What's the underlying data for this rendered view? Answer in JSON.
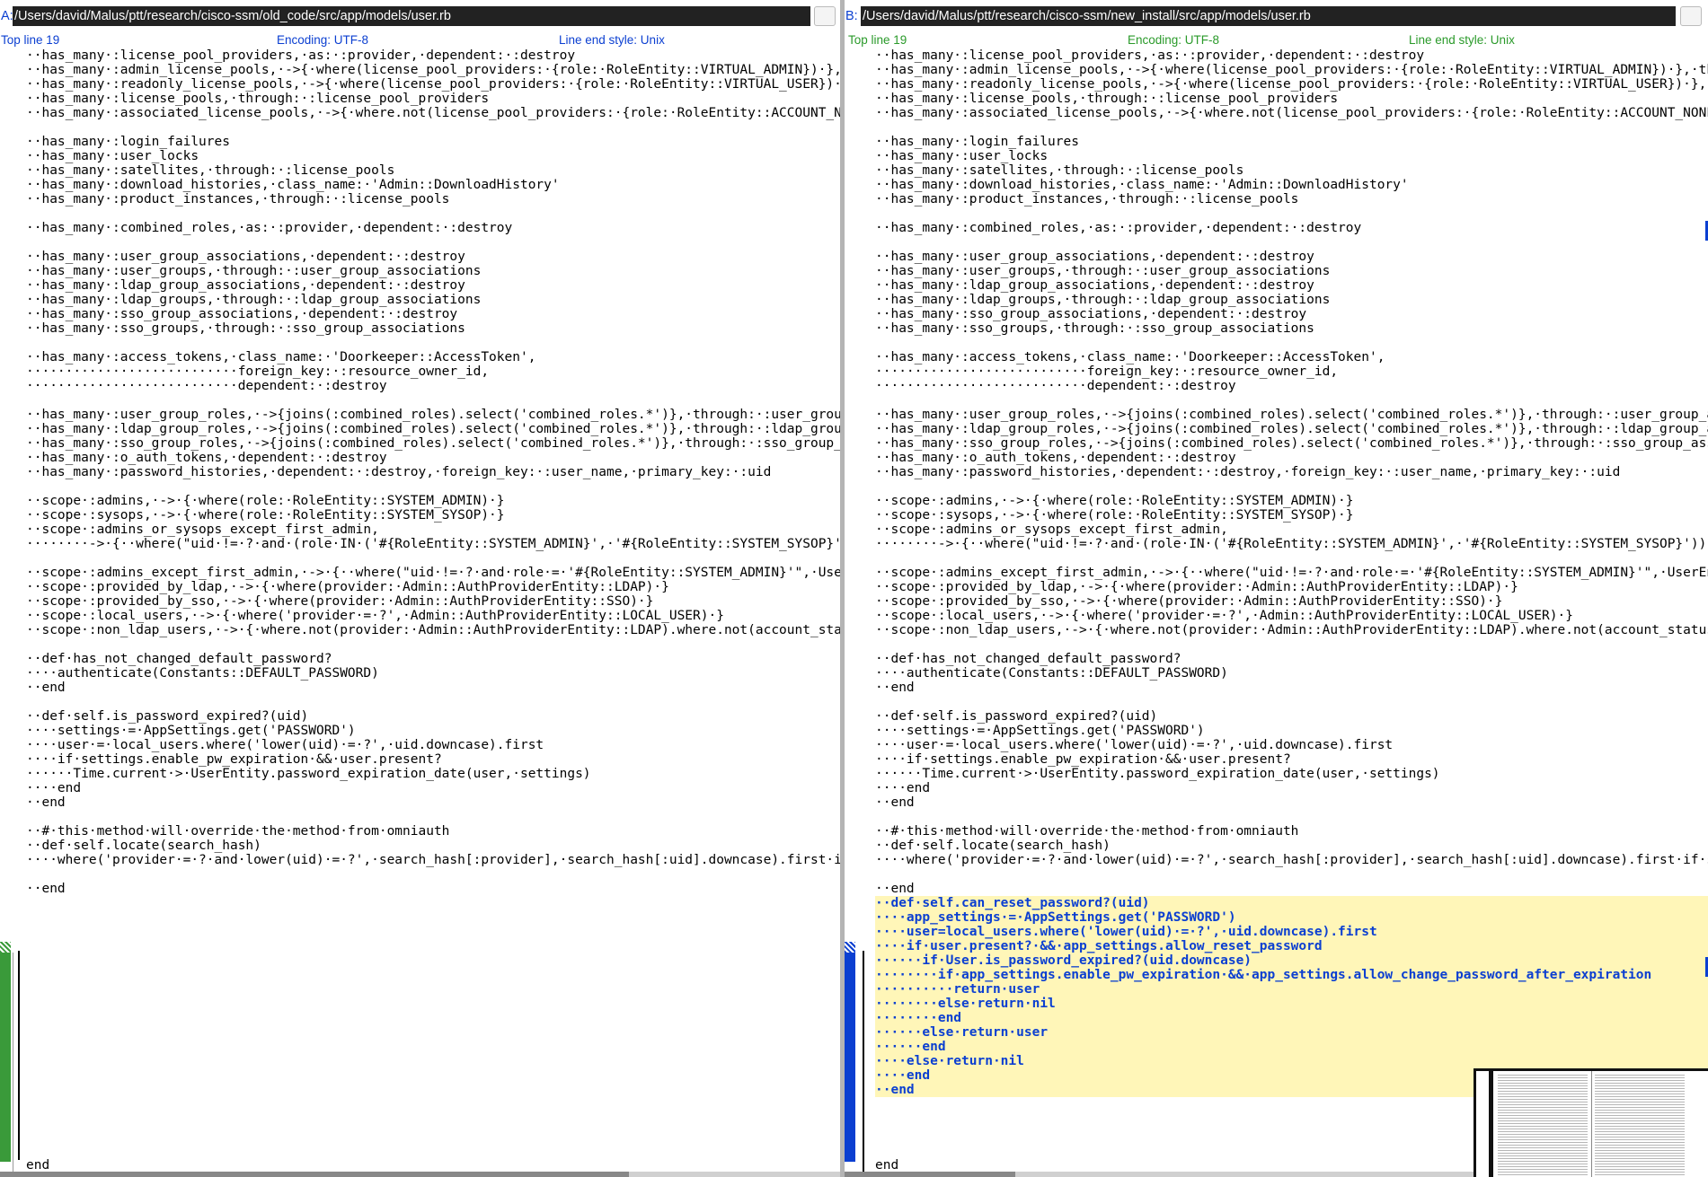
{
  "left": {
    "tag": "A:",
    "path": "/Users/david/Malus/ptt/research/cisco-ssm/old_code/src/app/models/user.rb",
    "top_line": "Top line 19",
    "encoding": "Encoding: UTF-8",
    "line_end": "Line end style: Unix",
    "lines": [
      "··has_many·:license_pool_providers,·as:·:provider,·dependent:·:destroy",
      "··has_many·:admin_license_pools,·->{·where(license_pool_providers:·{role:·RoleEntity::VIRTUAL_ADMIN})·},·thr",
      "··has_many·:readonly_license_pools,·->{·where(license_pool_providers:·{role:·RoleEntity::VIRTUAL_USER})·},·t",
      "··has_many·:license_pools,·through:·:license_pool_providers",
      "··has_many·:associated_license_pools,·->{·where.not(license_pool_providers:·{role:·RoleEntity::ACCOUNT_NONE}",
      "",
      "··has_many·:login_failures",
      "··has_many·:user_locks",
      "··has_many·:satellites,·through:·:license_pools",
      "··has_many·:download_histories,·class_name:·'Admin::DownloadHistory'",
      "··has_many·:product_instances,·through:·:license_pools",
      "",
      "··has_many·:combined_roles,·as:·:provider,·dependent:·:destroy",
      "",
      "··has_many·:user_group_associations,·dependent:·:destroy",
      "··has_many·:user_groups,·through:·:user_group_associations",
      "··has_many·:ldap_group_associations,·dependent:·:destroy",
      "··has_many·:ldap_groups,·through:·:ldap_group_associations",
      "··has_many·:sso_group_associations,·dependent:·:destroy",
      "··has_many·:sso_groups,·through:·:sso_group_associations",
      "",
      "··has_many·:access_tokens,·class_name:·'Doorkeeper::AccessToken',",
      "···························foreign_key:·:resource_owner_id,",
      "···························dependent:·:destroy",
      "",
      "··has_many·:user_group_roles,·->{joins(:combined_roles).select('combined_roles.*')},·through:·:user_group_as",
      "··has_many·:ldap_group_roles,·->{joins(:combined_roles).select('combined_roles.*')},·through:·:ldap_group_as",
      "··has_many·:sso_group_roles,·->{joins(:combined_roles).select('combined_roles.*')},·through:·:sso_group_asso",
      "··has_many·:o_auth_tokens,·dependent:·:destroy",
      "··has_many·:password_histories,·dependent:·:destroy,·foreign_key:·:user_name,·primary_key:·:uid",
      "",
      "··scope·:admins,·->·{·where(role:·RoleEntity::SYSTEM_ADMIN)·}",
      "··scope·:sysops,·->·{·where(role:·RoleEntity::SYSTEM_SYSOP)·}",
      "··scope·:admins_or_sysops_except_first_admin,",
      "········->·{··where(\"uid·!=·?·and·(role·IN·('#{RoleEntity::SYSTEM_ADMIN}',·'#{RoleEntity::SYSTEM_SYSOP}'))·\"",
      "",
      "··scope·:admins_except_first_admin,·->·{··where(\"uid·!=·?·and·role·=·'#{RoleEntity::SYSTEM_ADMIN}'\",·UserEnt",
      "··scope·:provided_by_ldap,·->·{·where(provider:·Admin::AuthProviderEntity::LDAP)·}",
      "··scope·:provided_by_sso,·->·{·where(provider:·Admin::AuthProviderEntity::SSO)·}",
      "··scope·:local_users,·->·{·where('provider·=·?',·Admin::AuthProviderEntity::LOCAL_USER)·}",
      "··scope·:non_ldap_users,·->·{·where.not(provider:·Admin::AuthProviderEntity::LDAP).where.not(account_status:",
      "",
      "··def·has_not_changed_default_password?",
      "····authenticate(Constants::DEFAULT_PASSWORD)",
      "··end",
      "",
      "··def·self.is_password_expired?(uid)",
      "····settings·=·AppSettings.get('PASSWORD')",
      "····user·=·local_users.where('lower(uid)·=·?',·uid.downcase).first",
      "····if·settings.enable_pw_expiration·&&·user.present?",
      "······Time.current·>·UserEntity.password_expiration_date(user,·settings)",
      "····end",
      "··end",
      "",
      "··#·this·method·will·override·the·method·from·omniauth",
      "··def·self.locate(search_hash)",
      "····where('provider·=·?·and·lower(uid)·=·?',·search_hash[:provider],·search_hash[:uid].downcase).first·if·se",
      "",
      "··end"
    ],
    "final_end": "end"
  },
  "right": {
    "tag": "B:",
    "path": "/Users/david/Malus/ptt/research/cisco-ssm/new_install/src/app/models/user.rb",
    "top_line": "Top line 19",
    "encoding": "Encoding: UTF-8",
    "line_end": "Line end style: Unix",
    "lines": [
      "··has_many·:license_pool_providers,·as:·:provider,·dependent:·:destroy",
      "··has_many·:admin_license_pools,·->{·where(license_pool_providers:·{role:·RoleEntity::VIRTUAL_ADMIN})·},·thr",
      "··has_many·:readonly_license_pools,·->{·where(license_pool_providers:·{role:·RoleEntity::VIRTUAL_USER})·},·t",
      "··has_many·:license_pools,·through:·:license_pool_providers",
      "··has_many·:associated_license_pools,·->{·where.not(license_pool_providers:·{role:·RoleEntity::ACCOUNT_NONE}",
      "",
      "··has_many·:login_failures",
      "··has_many·:user_locks",
      "··has_many·:satellites,·through:·:license_pools",
      "··has_many·:download_histories,·class_name:·'Admin::DownloadHistory'",
      "··has_many·:product_instances,·through:·:license_pools",
      "",
      "··has_many·:combined_roles,·as:·:provider,·dependent:·:destroy",
      "",
      "··has_many·:user_group_associations,·dependent:·:destroy",
      "··has_many·:user_groups,·through:·:user_group_associations",
      "··has_many·:ldap_group_associations,·dependent:·:destroy",
      "··has_many·:ldap_groups,·through:·:ldap_group_associations",
      "··has_many·:sso_group_associations,·dependent:·:destroy",
      "··has_many·:sso_groups,·through:·:sso_group_associations",
      "",
      "··has_many·:access_tokens,·class_name:·'Doorkeeper::AccessToken',",
      "···························foreign_key:·:resource_owner_id,",
      "···························dependent:·:destroy",
      "",
      "··has_many·:user_group_roles,·->{joins(:combined_roles).select('combined_roles.*')},·through:·:user_group_as",
      "··has_many·:ldap_group_roles,·->{joins(:combined_roles).select('combined_roles.*')},·through:·:ldap_group_as",
      "··has_many·:sso_group_roles,·->{joins(:combined_roles).select('combined_roles.*')},·through:·:sso_group_asso",
      "··has_many·:o_auth_tokens,·dependent:·:destroy",
      "··has_many·:password_histories,·dependent:·:destroy,·foreign_key:·:user_name,·primary_key:·:uid",
      "",
      "··scope·:admins,·->·{·where(role:·RoleEntity::SYSTEM_ADMIN)·}",
      "··scope·:sysops,·->·{·where(role:·RoleEntity::SYSTEM_SYSOP)·}",
      "··scope·:admins_or_sysops_except_first_admin,",
      "········->·{··where(\"uid·!=·?·and·(role·IN·('#{RoleEntity::SYSTEM_ADMIN}',·'#{RoleEntity::SYSTEM_SYSOP}'))·\"",
      "",
      "··scope·:admins_except_first_admin,·->·{··where(\"uid·!=·?·and·role·=·'#{RoleEntity::SYSTEM_ADMIN}'\",·UserEnt",
      "··scope·:provided_by_ldap,·->·{·where(provider:·Admin::AuthProviderEntity::LDAP)·}",
      "··scope·:provided_by_sso,·->·{·where(provider:·Admin::AuthProviderEntity::SSO)·}",
      "··scope·:local_users,·->·{·where('provider·=·?',·Admin::AuthProviderEntity::LOCAL_USER)·}",
      "··scope·:non_ldap_users,·->·{·where.not(provider:·Admin::AuthProviderEntity::LDAP).where.not(account_status:",
      "",
      "··def·has_not_changed_default_password?",
      "····authenticate(Constants::DEFAULT_PASSWORD)",
      "··end",
      "",
      "··def·self.is_password_expired?(uid)",
      "····settings·=·AppSettings.get('PASSWORD')",
      "····user·=·local_users.where('lower(uid)·=·?',·uid.downcase).first",
      "····if·settings.enable_pw_expiration·&&·user.present?",
      "······Time.current·>·UserEntity.password_expiration_date(user,·settings)",
      "····end",
      "··end",
      "",
      "··#·this·method·will·override·the·method·from·omniauth",
      "··def·self.locate(search_hash)",
      "····where('provider·=·?·and·lower(uid)·=·?',·search_hash[:provider],·search_hash[:uid].downcase).first·if·se",
      "",
      "··end"
    ],
    "added_lines": [
      "··def·self.can_reset_password?(uid)",
      "····app_settings·=·AppSettings.get('PASSWORD')",
      "····user=local_users.where('lower(uid)·=·?',·uid.downcase).first",
      "····if·user.present?·&&·app_settings.allow_reset_password",
      "······if·User.is_password_expired?(uid.downcase)",
      "········if·app_settings.enable_pw_expiration·&&·app_settings.allow_change_password_after_expiration",
      "··········return·user",
      "········else·return·nil",
      "········end",
      "······else·return·user",
      "······end",
      "····else·return·nil",
      "····end",
      "··end"
    ],
    "final_end": "end"
  },
  "colors": {
    "tag_blue": "#0b3fd1",
    "info_green": "#2a9a2a",
    "added_bg": "#fff6b8",
    "gutter_green": "#3a9a3a"
  }
}
